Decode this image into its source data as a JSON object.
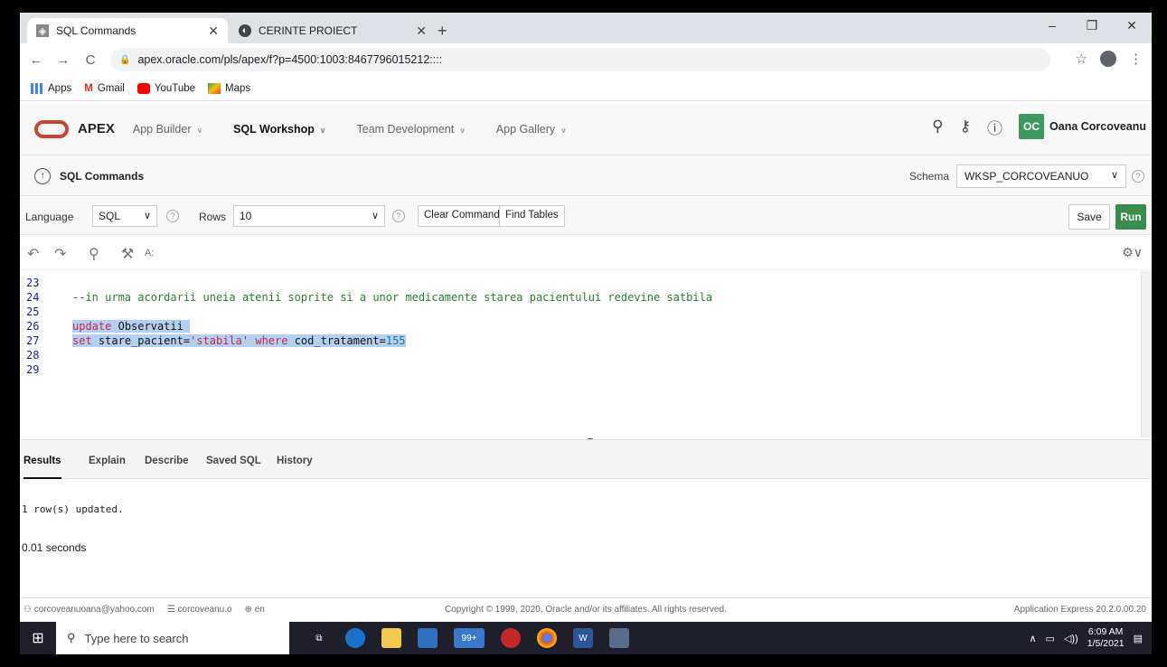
{
  "browser": {
    "tabs": [
      {
        "title": "SQL Commands",
        "active": true
      },
      {
        "title": "CERINTE PROIECT",
        "active": false
      }
    ],
    "url": "apex.oracle.com/pls/apex/f?p=4500:1003:8467796015212::::",
    "bookmarks": [
      "Apps",
      "Gmail",
      "YouTube",
      "Maps"
    ]
  },
  "apex": {
    "brand": "APEX",
    "nav": [
      "App Builder",
      "SQL Workshop",
      "Team Development",
      "App Gallery"
    ],
    "active_nav": "SQL Workshop",
    "user_initials": "OC",
    "user_name": "Oana Corcoveanu",
    "accent_color": "#3d9a5f"
  },
  "page": {
    "title": "SQL Commands",
    "schema_label": "Schema",
    "schema_value": "WKSP_CORCOVEANUO"
  },
  "toolbar": {
    "language_label": "Language",
    "language_value": "SQL",
    "rows_label": "Rows",
    "rows_value": "10",
    "clear_label": "Clear Command",
    "find_label": "Find Tables",
    "save_label": "Save",
    "run_label": "Run"
  },
  "editor": {
    "line_numbers": [
      "23",
      "24",
      "25",
      "26",
      "27",
      "28",
      "29"
    ],
    "comment": "--in urma acordarii uneia atenii soprite si a unor medicamente starea pacientului redevine satbila",
    "line26_kw": "update",
    "line26_id": "Observatii",
    "line27_kw1": "set",
    "line27_id1": "stare_pacient=",
    "line27_str": "'stabila'",
    "line27_kw2": "where",
    "line27_id2": "cod_tratament=",
    "line27_num": "155"
  },
  "results": {
    "tabs": [
      "Results",
      "Explain",
      "Describe",
      "Saved SQL",
      "History"
    ],
    "message": "1 row(s) updated.",
    "time": "0.01 seconds"
  },
  "footer": {
    "email": "corcoveanuoana@yahoo.com",
    "workspace": "corcoveanu.o",
    "lang": "en",
    "copyright": "Copyright © 1999, 2020, Oracle and/or its affiliates. All rights reserved.",
    "version": "Application Express 20.2.0.00.20"
  },
  "taskbar": {
    "search_placeholder": "Type here to search",
    "time": "6:09 AM",
    "date": "1/5/2021",
    "badge": "99+"
  }
}
